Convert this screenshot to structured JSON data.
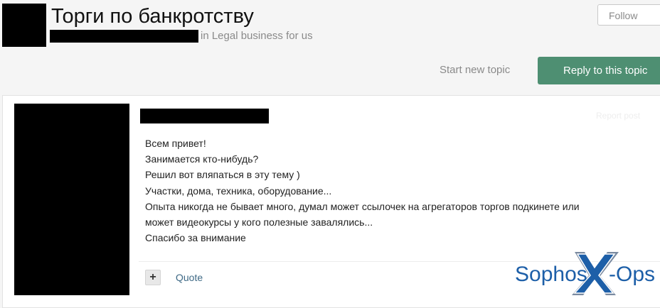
{
  "header": {
    "title": "Торги по банкротству",
    "subtitle": "in Legal business for us",
    "follow_label": "Follow"
  },
  "actions": {
    "start_topic": "Start new topic",
    "reply": "Reply to this topic"
  },
  "post": {
    "report_label": "Report post",
    "lines": [
      "Всем привет!",
      "Занимается кто-нибудь?",
      "Решил вот вляпаться в эту тему )",
      "Участки, дома, техника, оборудование...",
      "Опыта никогда не бывает много, думал может ссылочек на агрегаторов торгов подкинете или",
      "может видеокурсы у кого полезные завалялись...",
      "Спасибо за внимание"
    ],
    "plus_label": "+",
    "quote_label": "Quote"
  },
  "watermark": {
    "brand_left": "Sophos",
    "brand_x": "X",
    "brand_right": "-Ops",
    "color": "#1d5fa8"
  }
}
